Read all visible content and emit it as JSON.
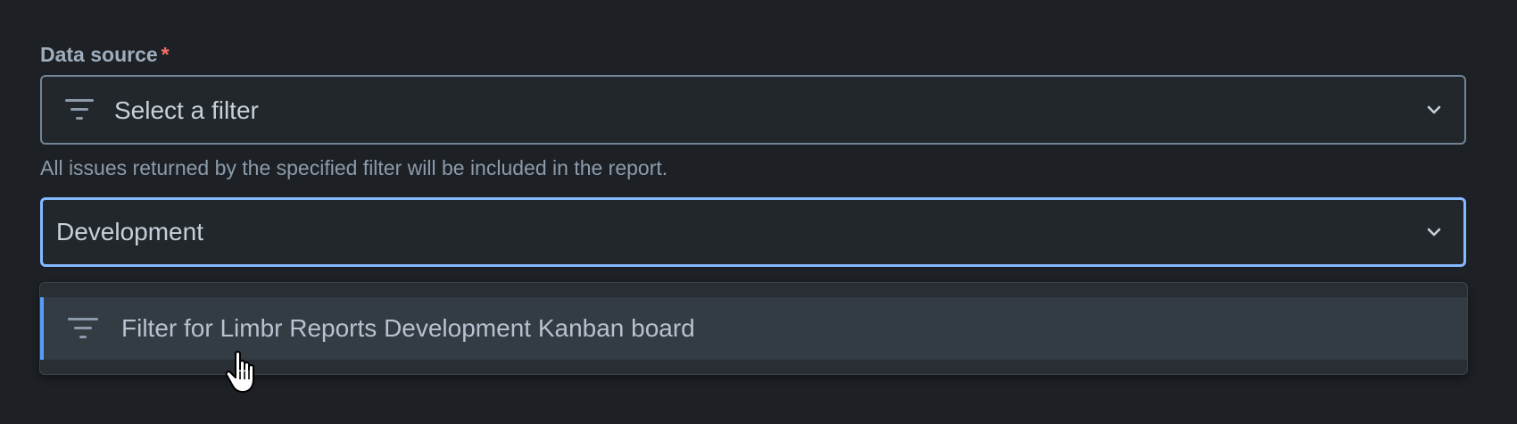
{
  "data_source": {
    "label": "Data source",
    "required_marker": "*",
    "select": {
      "placeholder": "Select a filter",
      "icon": "filter-icon",
      "chevron": "chevron-down-icon"
    },
    "helper_text": "All issues returned by the specified filter will be included in the report."
  },
  "search": {
    "value": "Development",
    "chevron": "chevron-down-icon"
  },
  "dropdown": {
    "options": [
      {
        "label": "Filter for Limbr Reports Development Kanban board",
        "icon": "filter-icon",
        "highlighted": true
      }
    ]
  },
  "colors": {
    "background": "#1d2125",
    "focus_border": "#85b8ff",
    "highlight_accent": "#579dff",
    "required": "#f87168"
  },
  "cursor": "hand-pointer"
}
